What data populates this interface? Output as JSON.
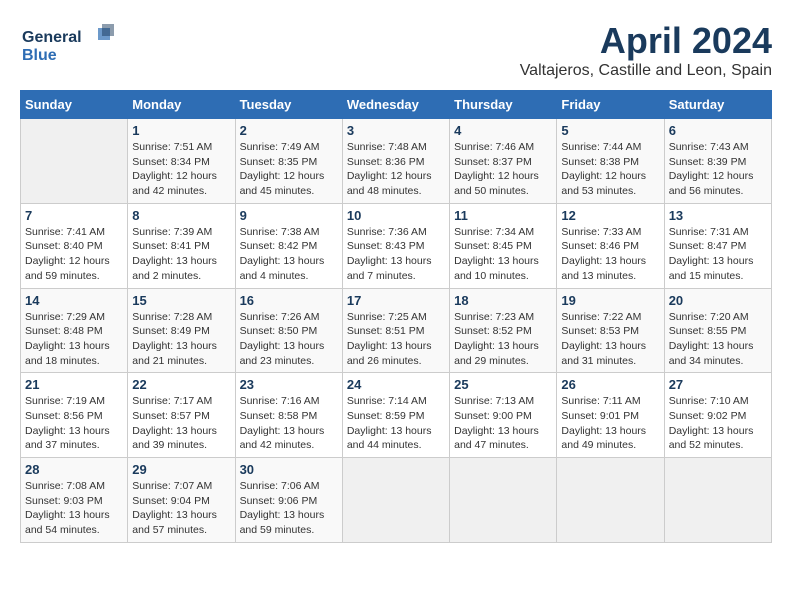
{
  "logo": {
    "line1": "General",
    "line2": "Blue"
  },
  "title": "April 2024",
  "location": "Valtajeros, Castille and Leon, Spain",
  "days_of_week": [
    "Sunday",
    "Monday",
    "Tuesday",
    "Wednesday",
    "Thursday",
    "Friday",
    "Saturday"
  ],
  "weeks": [
    [
      {
        "day": "",
        "info": ""
      },
      {
        "day": "1",
        "info": "Sunrise: 7:51 AM\nSunset: 8:34 PM\nDaylight: 12 hours\nand 42 minutes."
      },
      {
        "day": "2",
        "info": "Sunrise: 7:49 AM\nSunset: 8:35 PM\nDaylight: 12 hours\nand 45 minutes."
      },
      {
        "day": "3",
        "info": "Sunrise: 7:48 AM\nSunset: 8:36 PM\nDaylight: 12 hours\nand 48 minutes."
      },
      {
        "day": "4",
        "info": "Sunrise: 7:46 AM\nSunset: 8:37 PM\nDaylight: 12 hours\nand 50 minutes."
      },
      {
        "day": "5",
        "info": "Sunrise: 7:44 AM\nSunset: 8:38 PM\nDaylight: 12 hours\nand 53 minutes."
      },
      {
        "day": "6",
        "info": "Sunrise: 7:43 AM\nSunset: 8:39 PM\nDaylight: 12 hours\nand 56 minutes."
      }
    ],
    [
      {
        "day": "7",
        "info": "Sunrise: 7:41 AM\nSunset: 8:40 PM\nDaylight: 12 hours\nand 59 minutes."
      },
      {
        "day": "8",
        "info": "Sunrise: 7:39 AM\nSunset: 8:41 PM\nDaylight: 13 hours\nand 2 minutes."
      },
      {
        "day": "9",
        "info": "Sunrise: 7:38 AM\nSunset: 8:42 PM\nDaylight: 13 hours\nand 4 minutes."
      },
      {
        "day": "10",
        "info": "Sunrise: 7:36 AM\nSunset: 8:43 PM\nDaylight: 13 hours\nand 7 minutes."
      },
      {
        "day": "11",
        "info": "Sunrise: 7:34 AM\nSunset: 8:45 PM\nDaylight: 13 hours\nand 10 minutes."
      },
      {
        "day": "12",
        "info": "Sunrise: 7:33 AM\nSunset: 8:46 PM\nDaylight: 13 hours\nand 13 minutes."
      },
      {
        "day": "13",
        "info": "Sunrise: 7:31 AM\nSunset: 8:47 PM\nDaylight: 13 hours\nand 15 minutes."
      }
    ],
    [
      {
        "day": "14",
        "info": "Sunrise: 7:29 AM\nSunset: 8:48 PM\nDaylight: 13 hours\nand 18 minutes."
      },
      {
        "day": "15",
        "info": "Sunrise: 7:28 AM\nSunset: 8:49 PM\nDaylight: 13 hours\nand 21 minutes."
      },
      {
        "day": "16",
        "info": "Sunrise: 7:26 AM\nSunset: 8:50 PM\nDaylight: 13 hours\nand 23 minutes."
      },
      {
        "day": "17",
        "info": "Sunrise: 7:25 AM\nSunset: 8:51 PM\nDaylight: 13 hours\nand 26 minutes."
      },
      {
        "day": "18",
        "info": "Sunrise: 7:23 AM\nSunset: 8:52 PM\nDaylight: 13 hours\nand 29 minutes."
      },
      {
        "day": "19",
        "info": "Sunrise: 7:22 AM\nSunset: 8:53 PM\nDaylight: 13 hours\nand 31 minutes."
      },
      {
        "day": "20",
        "info": "Sunrise: 7:20 AM\nSunset: 8:55 PM\nDaylight: 13 hours\nand 34 minutes."
      }
    ],
    [
      {
        "day": "21",
        "info": "Sunrise: 7:19 AM\nSunset: 8:56 PM\nDaylight: 13 hours\nand 37 minutes."
      },
      {
        "day": "22",
        "info": "Sunrise: 7:17 AM\nSunset: 8:57 PM\nDaylight: 13 hours\nand 39 minutes."
      },
      {
        "day": "23",
        "info": "Sunrise: 7:16 AM\nSunset: 8:58 PM\nDaylight: 13 hours\nand 42 minutes."
      },
      {
        "day": "24",
        "info": "Sunrise: 7:14 AM\nSunset: 8:59 PM\nDaylight: 13 hours\nand 44 minutes."
      },
      {
        "day": "25",
        "info": "Sunrise: 7:13 AM\nSunset: 9:00 PM\nDaylight: 13 hours\nand 47 minutes."
      },
      {
        "day": "26",
        "info": "Sunrise: 7:11 AM\nSunset: 9:01 PM\nDaylight: 13 hours\nand 49 minutes."
      },
      {
        "day": "27",
        "info": "Sunrise: 7:10 AM\nSunset: 9:02 PM\nDaylight: 13 hours\nand 52 minutes."
      }
    ],
    [
      {
        "day": "28",
        "info": "Sunrise: 7:08 AM\nSunset: 9:03 PM\nDaylight: 13 hours\nand 54 minutes."
      },
      {
        "day": "29",
        "info": "Sunrise: 7:07 AM\nSunset: 9:04 PM\nDaylight: 13 hours\nand 57 minutes."
      },
      {
        "day": "30",
        "info": "Sunrise: 7:06 AM\nSunset: 9:06 PM\nDaylight: 13 hours\nand 59 minutes."
      },
      {
        "day": "",
        "info": ""
      },
      {
        "day": "",
        "info": ""
      },
      {
        "day": "",
        "info": ""
      },
      {
        "day": "",
        "info": ""
      }
    ]
  ]
}
